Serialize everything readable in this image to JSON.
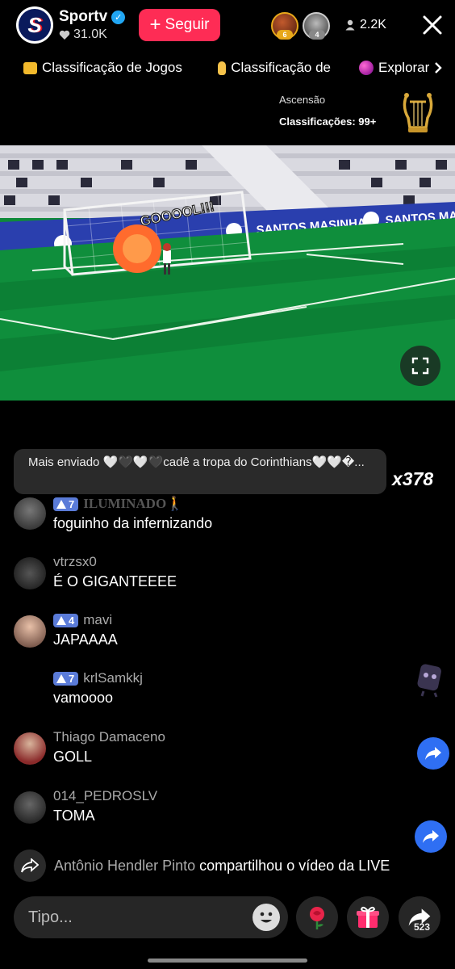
{
  "channel": {
    "name": "Sportv",
    "likes": "31.0K"
  },
  "follow_label": "Seguir",
  "viewer_badges": [
    "6",
    "4"
  ],
  "viewer_count": "2.2K",
  "tabs": [
    {
      "label": "Classificação de Jogos",
      "icon": "crown-icon"
    },
    {
      "label": "Classificação de",
      "icon": "hand-icon"
    },
    {
      "label": "Explorar",
      "icon": "orb-icon"
    }
  ],
  "ascension": {
    "title": "Ascensão",
    "rank": "Classificações: 99+"
  },
  "video": {
    "banner_text": "SANTOS MASINHA",
    "goal_text": "GOOOOL!!!"
  },
  "pinned": {
    "text": "Mais enviado 🤍🖤🤍🖤cadê a tropa do Corinthians🤍🤍�...",
    "multiplier": "x378"
  },
  "messages": [
    {
      "user": "ILUMINADO🚶",
      "level": "7",
      "text": "foguinho da infernizando"
    },
    {
      "user": "vtrzsx0",
      "level": "",
      "text": "É O GIGANTEEEE"
    },
    {
      "user": "mavi",
      "level": "4",
      "text": "JAPAAAA"
    },
    {
      "user": "krlSamkkj",
      "level": "7",
      "text": "vamoooo"
    },
    {
      "user": "Thiago Damaceno",
      "level": "",
      "text": "GOLL"
    },
    {
      "user": "014_PEDROSLV",
      "level": "",
      "text": "TOMA"
    }
  ],
  "share_notice": {
    "who": "Antônio Hendler Pinto",
    "action": "compartilhou o vídeo da LIVE"
  },
  "input": {
    "placeholder": "Tipo..."
  },
  "share_count": "523",
  "colors": {
    "accent": "#fe2c55",
    "level_badge": "#5a7bd8",
    "share_blue": "#2f6ff3"
  }
}
